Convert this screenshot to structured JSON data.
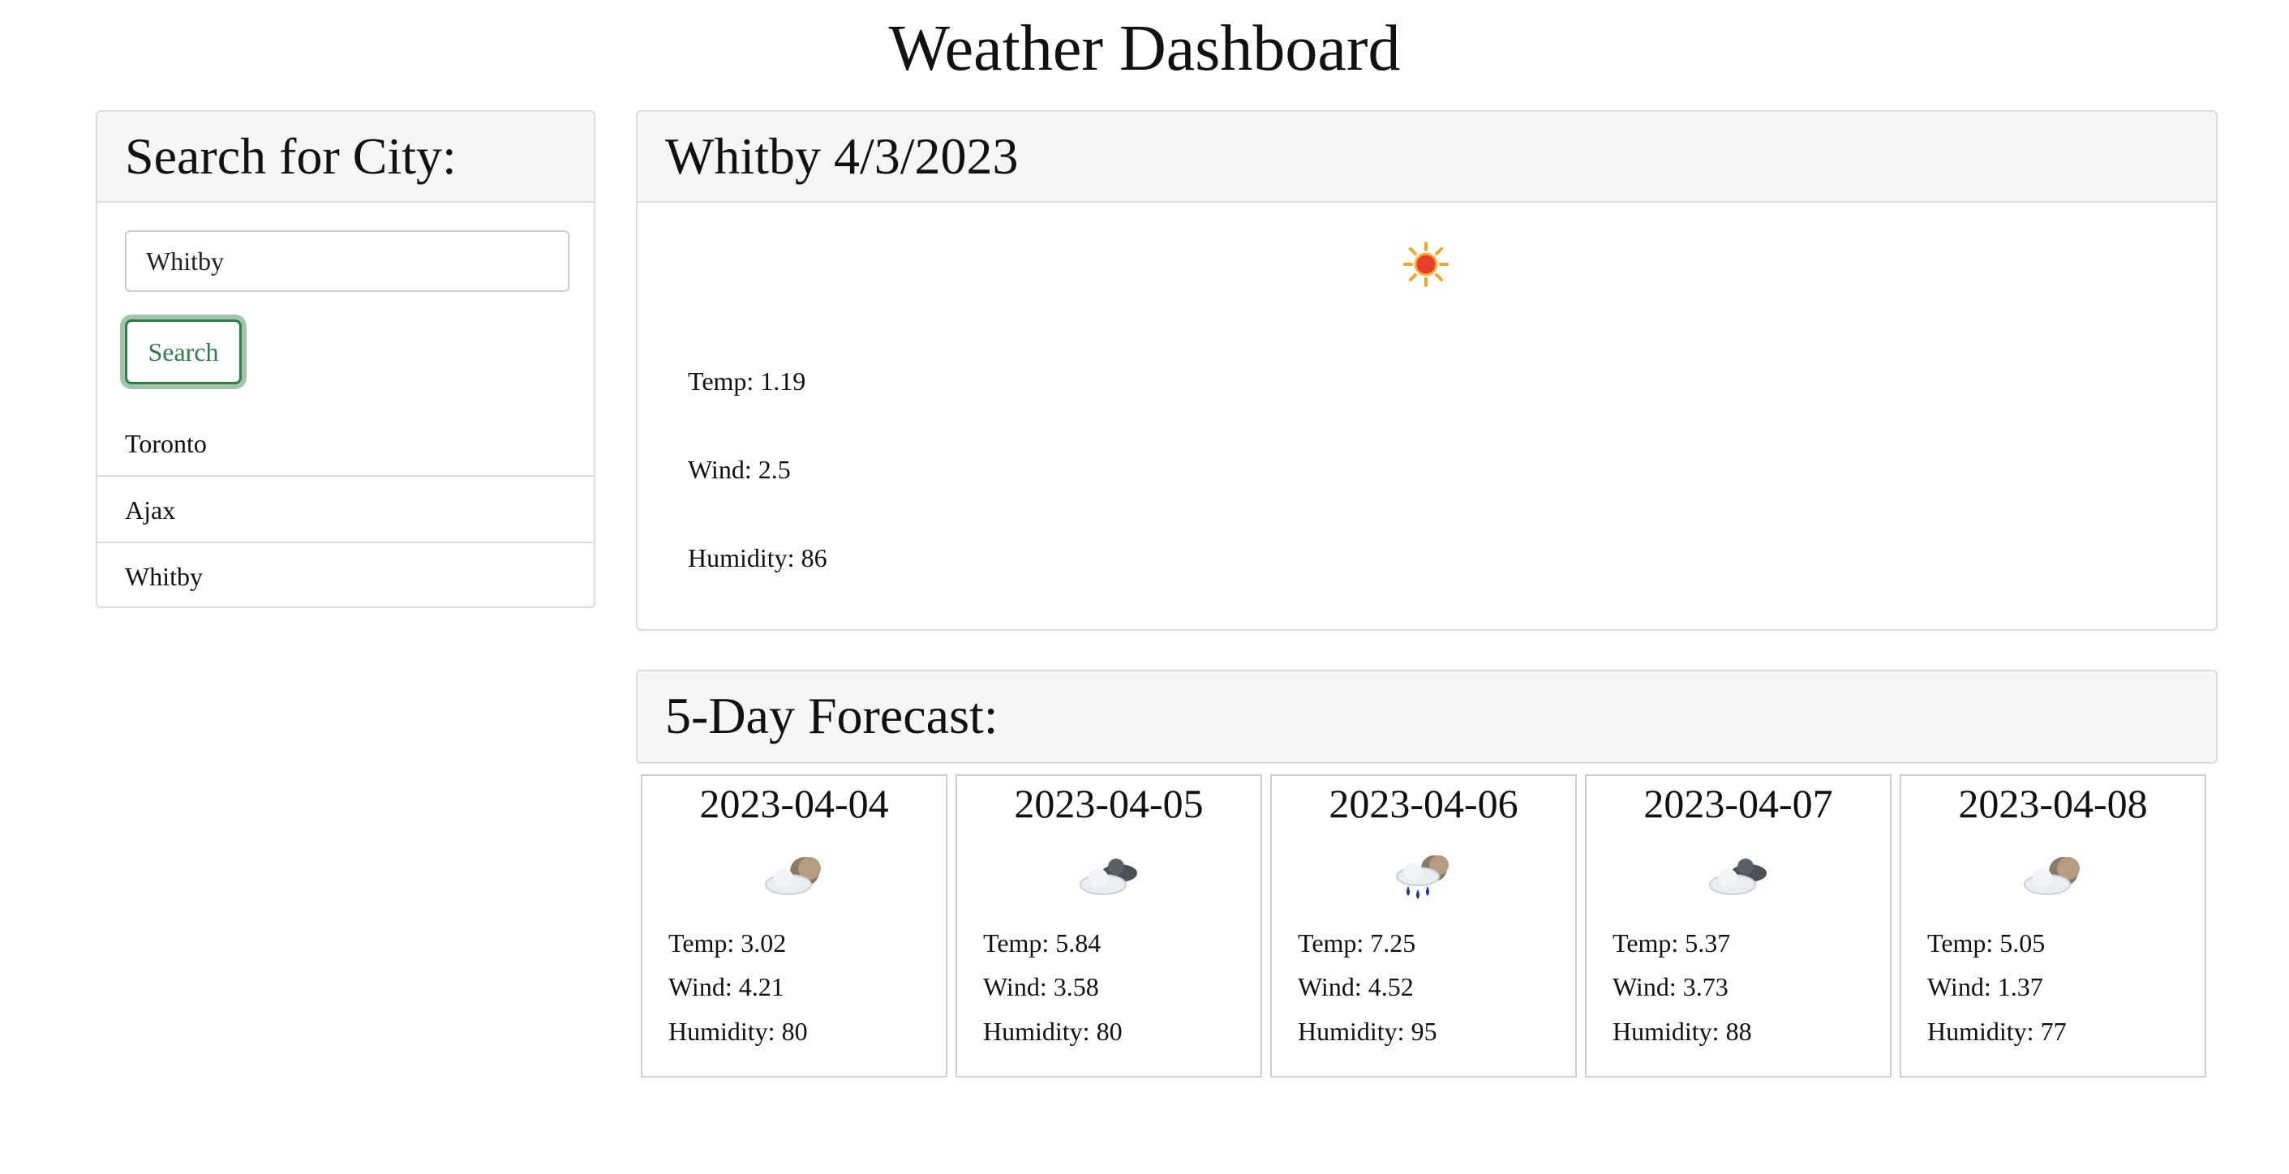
{
  "page": {
    "title": "Weather Dashboard"
  },
  "search": {
    "heading": "Search for City:",
    "input_value": "Whitby",
    "button_label": "Search",
    "history": [
      "Toronto",
      "Ajax",
      "Whitby"
    ]
  },
  "current": {
    "heading": "Whitby 4/3/2023",
    "icon": "sun-icon",
    "temp": "Temp: 1.19",
    "wind": "Wind: 2.5",
    "humidity": "Humidity: 86"
  },
  "forecast": {
    "heading": "5-Day Forecast:",
    "days": [
      {
        "date": "2023-04-04",
        "icon": "partly-cloudy-night-icon",
        "temp": "Temp: 3.02",
        "wind": "Wind: 4.21",
        "humidity": "Humidity: 80"
      },
      {
        "date": "2023-04-05",
        "icon": "broken-clouds-icon",
        "temp": "Temp: 5.84",
        "wind": "Wind: 3.58",
        "humidity": "Humidity: 80"
      },
      {
        "date": "2023-04-06",
        "icon": "rain-night-icon",
        "temp": "Temp: 7.25",
        "wind": "Wind: 4.52",
        "humidity": "Humidity: 95"
      },
      {
        "date": "2023-04-07",
        "icon": "broken-clouds-icon",
        "temp": "Temp: 5.37",
        "wind": "Wind: 3.73",
        "humidity": "Humidity: 88"
      },
      {
        "date": "2023-04-08",
        "icon": "partly-cloudy-night-icon",
        "temp": "Temp: 5.05",
        "wind": "Wind: 1.37",
        "humidity": "Humidity: 77"
      }
    ]
  },
  "colors": {
    "accent": "#2e7d45",
    "panel_header_bg": "#f6f6f6",
    "border": "#dcdcdc"
  }
}
